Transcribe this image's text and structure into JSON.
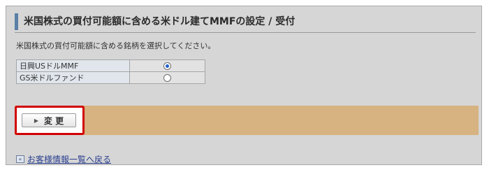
{
  "page": {
    "title": "米国株式の買付可能額に含める米ドル建てMMFの設定 / 受付",
    "instruction": "米国株式の買付可能額に含める銘柄を選択してください。"
  },
  "funds": [
    {
      "name": "日興USドルMMF",
      "selected": true
    },
    {
      "name": "GS米ドルファンド",
      "selected": false
    }
  ],
  "actions": {
    "change_label": "変 更",
    "change_icon": "triangle-right-icon",
    "highlight_color": "#d20000"
  },
  "back": {
    "label": "お客様情報一覧へ戻る",
    "icon": "double-left-arrow-icon",
    "icon_glyph": "«"
  },
  "colors": {
    "band": "#d6b381",
    "title_accent": "#5b7fa6",
    "link": "#2a3f8f"
  }
}
